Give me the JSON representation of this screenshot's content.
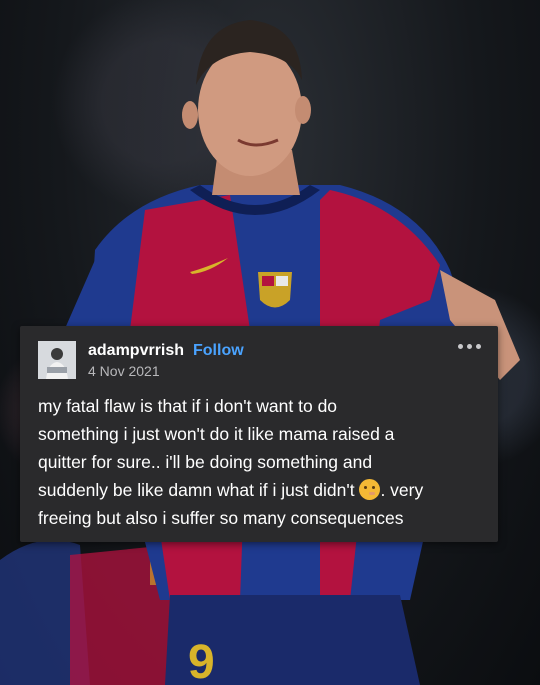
{
  "post": {
    "username": "adampvrrish",
    "follow_label": "Follow",
    "date": "4 Nov 2021",
    "body_lines": [
      "my fatal flaw is that if i don't want to do",
      "something i just won't do it like mama raised a",
      "quitter for sure.. i'll be doing something and",
      "suddenly be like damn what if i just didn't",
      "freeing but also i suffer so many consequences"
    ],
    "body_line4_suffix": ". very",
    "emoji": "thinking-face-emoji"
  },
  "colors": {
    "card_bg": "#2a2a2c",
    "follow": "#4aa3ff",
    "jersey_red": "#b3123f",
    "jersey_blue": "#1f3a8f"
  }
}
